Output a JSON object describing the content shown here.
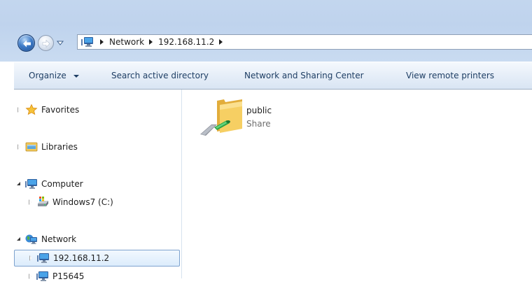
{
  "address_bar": {
    "location_icon": "computer-network-icon",
    "breadcrumbs": [
      {
        "label": "Network"
      },
      {
        "label": "192.168.11.2"
      }
    ]
  },
  "navigation_buttons": {
    "back_icon": "back-arrow-icon",
    "forward_icon": "forward-arrow-icon",
    "recent_icon": "recent-pages-dropdown-icon"
  },
  "command_bar": {
    "organize": "Organize",
    "search_active_directory": "Search active directory",
    "network_and_sharing_center": "Network and Sharing Center",
    "view_remote_printers": "View remote printers"
  },
  "nav_pane": {
    "items": [
      {
        "label": "Favorites",
        "icon": "star-icon",
        "state": "collapsed",
        "level": 0
      },
      {
        "label": "Libraries",
        "icon": "libraries-icon",
        "state": "collapsed",
        "level": 0
      },
      {
        "label": "Computer",
        "icon": "computer-icon",
        "state": "expanded",
        "level": 0
      },
      {
        "label": "Windows7 (C:)",
        "icon": "drive-icon",
        "state": "collapsed",
        "level": 1
      },
      {
        "label": "Network",
        "icon": "network-icon",
        "state": "expanded",
        "level": 0
      },
      {
        "label": "192.168.11.2",
        "icon": "computer-icon",
        "state": "collapsed",
        "level": 1,
        "selected": true
      },
      {
        "label": "P15645",
        "icon": "computer-icon",
        "state": "collapsed",
        "level": 1
      }
    ]
  },
  "content": {
    "items": [
      {
        "name": "public",
        "type": "Share",
        "icon": "shared-folder-icon"
      }
    ]
  },
  "colors": {
    "title_bar": "#c3d6ee",
    "command_bar": "#e6eef8",
    "command_text": "#1e3e64",
    "selection_border": "#7da2ce",
    "selection_fill": "#dcecfc",
    "folder_yellow": "#f5c84f"
  }
}
